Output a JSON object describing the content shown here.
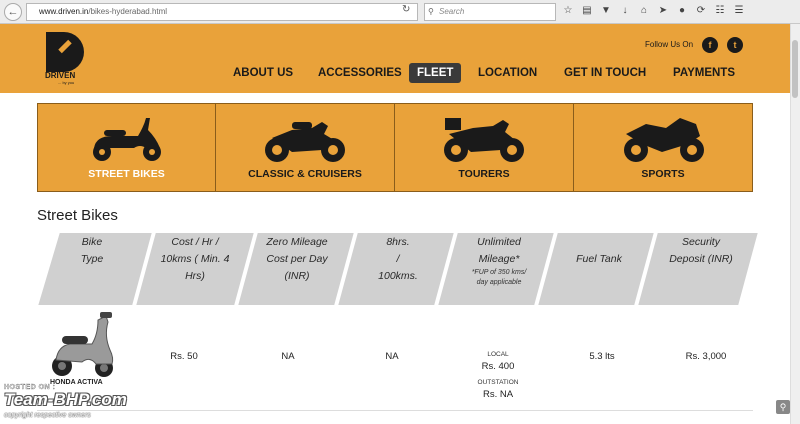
{
  "browser": {
    "url_host": "www.driven.in",
    "url_path": "/bikes-hyderabad.html",
    "search_placeholder": "Search",
    "toolbar_icons": [
      "star-icon",
      "clipboard-icon",
      "pocket-icon",
      "download-icon",
      "home-icon",
      "send-icon",
      "chat-icon",
      "sync-icon",
      "document-icon",
      "menu-icon"
    ]
  },
  "header": {
    "logo_text": "DRIVEN",
    "logo_sub": "... by you",
    "follow_label": "Follow Us On",
    "social": [
      "f",
      "t"
    ],
    "menu": [
      "ABOUT US",
      "ACCESSORIES",
      "FLEET",
      "LOCATION",
      "GET IN TOUCH",
      "PAYMENTS"
    ],
    "active_menu": "FLEET"
  },
  "categories": [
    {
      "label": "STREET BIKES",
      "icon": "scooter-icon",
      "selected": true
    },
    {
      "label": "CLASSIC & CRUISERS",
      "icon": "cruiser-bike-icon",
      "selected": false
    },
    {
      "label": "TOURERS",
      "icon": "tourer-bike-icon",
      "selected": false
    },
    {
      "label": "SPORTS",
      "icon": "sports-bike-icon",
      "selected": false
    }
  ],
  "section_title": "Street Bikes",
  "table": {
    "headers": [
      [
        "Bike",
        "Type"
      ],
      [
        "Cost / Hr /",
        "10kms ( Min. 4",
        "Hrs)"
      ],
      [
        "Zero Mileage",
        "Cost per Day",
        "(INR)"
      ],
      [
        "8hrs.",
        "/",
        "100kms."
      ],
      [
        "Unlimited",
        "Mileage*"
      ],
      [
        "Fuel Tank"
      ],
      [
        "Security",
        "Deposit (INR)"
      ]
    ],
    "header_note": [
      "*FUP of 350 kms/",
      "day applicable"
    ],
    "rows": [
      {
        "bike_name": "HONDA ACTIVA",
        "cost_per_hr": "Rs. 50",
        "zero_mileage": "NA",
        "eight_hrs": "NA",
        "local_label": "LOCAL",
        "local_value": "Rs. 400",
        "outstation_label": "OUTSTATION",
        "outstation_value": "Rs. NA",
        "fuel_tank": "5.3 lts",
        "deposit": "Rs. 3,000"
      }
    ]
  },
  "watermark": {
    "hosted": "HOSTED ON :",
    "brand": "Team-BHP.com",
    "copyright": "copyright respective owners"
  },
  "colors": {
    "brand_orange": "#e9a23a",
    "dark": "#1a1a1a",
    "header_gray": "#d0d0d0"
  }
}
